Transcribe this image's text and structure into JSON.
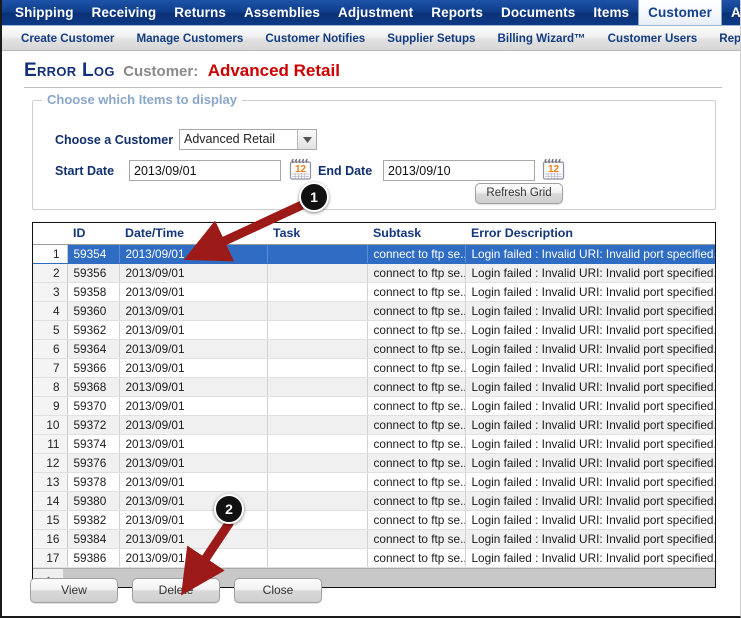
{
  "mainnav": {
    "items": [
      {
        "label": "Shipping",
        "active": false
      },
      {
        "label": "Receiving",
        "active": false
      },
      {
        "label": "Returns",
        "active": false
      },
      {
        "label": "Assemblies",
        "active": false
      },
      {
        "label": "Adjustment",
        "active": false
      },
      {
        "label": "Reports",
        "active": false
      },
      {
        "label": "Documents",
        "active": false
      },
      {
        "label": "Items",
        "active": false
      },
      {
        "label": "Customer",
        "active": true
      },
      {
        "label": "Ac",
        "active": false
      }
    ]
  },
  "subnav": {
    "items": [
      {
        "label": "Create Customer"
      },
      {
        "label": "Manage Customers"
      },
      {
        "label": "Customer Notifies"
      },
      {
        "label": "Supplier Setups"
      },
      {
        "label": "Billing Wizard™"
      },
      {
        "label": "Customer Users"
      },
      {
        "label": "Report Setups"
      }
    ]
  },
  "title": {
    "heading": "Error Log",
    "customer_label": "Customer:",
    "customer_name": "Advanced Retail"
  },
  "filter": {
    "legend": "Choose which Items to display",
    "customer_label": "Choose a Customer",
    "customer_value": "Advanced Retail",
    "start_label": "Start Date",
    "start_value": "2013/09/01",
    "end_label": "End Date",
    "end_value": "2013/09/10",
    "refresh_label": "Refresh Grid",
    "calendar_day": "12"
  },
  "grid": {
    "columns": [
      "",
      "ID",
      "Date/Time",
      "Task",
      "Subtask",
      "Error Description"
    ],
    "rows": [
      {
        "idx": "1",
        "id": "59354",
        "datetime": "2013/09/01",
        "task": "",
        "subtask": "connect to ftp se...",
        "error": "Login failed : Invalid URI: Invalid port specified.",
        "selected": true
      },
      {
        "idx": "2",
        "id": "59356",
        "datetime": "2013/09/01",
        "task": "",
        "subtask": "connect to ftp se...",
        "error": "Login failed : Invalid URI: Invalid port specified.",
        "selected": false
      },
      {
        "idx": "3",
        "id": "59358",
        "datetime": "2013/09/01",
        "task": "",
        "subtask": "connect to ftp se...",
        "error": "Login failed : Invalid URI: Invalid port specified.",
        "selected": false
      },
      {
        "idx": "4",
        "id": "59360",
        "datetime": "2013/09/01",
        "task": "",
        "subtask": "connect to ftp se...",
        "error": "Login failed : Invalid URI: Invalid port specified.",
        "selected": false
      },
      {
        "idx": "5",
        "id": "59362",
        "datetime": "2013/09/01",
        "task": "",
        "subtask": "connect to ftp se...",
        "error": "Login failed : Invalid URI: Invalid port specified.",
        "selected": false
      },
      {
        "idx": "6",
        "id": "59364",
        "datetime": "2013/09/01",
        "task": "",
        "subtask": "connect to ftp se...",
        "error": "Login failed : Invalid URI: Invalid port specified.",
        "selected": false
      },
      {
        "idx": "7",
        "id": "59366",
        "datetime": "2013/09/01",
        "task": "",
        "subtask": "connect to ftp se...",
        "error": "Login failed : Invalid URI: Invalid port specified.",
        "selected": false
      },
      {
        "idx": "8",
        "id": "59368",
        "datetime": "2013/09/01",
        "task": "",
        "subtask": "connect to ftp se...",
        "error": "Login failed : Invalid URI: Invalid port specified.",
        "selected": false
      },
      {
        "idx": "9",
        "id": "59370",
        "datetime": "2013/09/01",
        "task": "",
        "subtask": "connect to ftp se...",
        "error": "Login failed : Invalid URI: Invalid port specified.",
        "selected": false
      },
      {
        "idx": "10",
        "id": "59372",
        "datetime": "2013/09/01",
        "task": "",
        "subtask": "connect to ftp se...",
        "error": "Login failed : Invalid URI: Invalid port specified.",
        "selected": false
      },
      {
        "idx": "11",
        "id": "59374",
        "datetime": "2013/09/01",
        "task": "",
        "subtask": "connect to ftp se...",
        "error": "Login failed : Invalid URI: Invalid port specified.",
        "selected": false
      },
      {
        "idx": "12",
        "id": "59376",
        "datetime": "2013/09/01",
        "task": "",
        "subtask": "connect to ftp se...",
        "error": "Login failed : Invalid URI: Invalid port specified.",
        "selected": false
      },
      {
        "idx": "13",
        "id": "59378",
        "datetime": "2013/09/01",
        "task": "",
        "subtask": "connect to ftp se...",
        "error": "Login failed : Invalid URI: Invalid port specified.",
        "selected": false
      },
      {
        "idx": "14",
        "id": "59380",
        "datetime": "2013/09/01",
        "task": "",
        "subtask": "connect to ftp se...",
        "error": "Login failed : Invalid URI: Invalid port specified.",
        "selected": false
      },
      {
        "idx": "15",
        "id": "59382",
        "datetime": "2013/09/01",
        "task": "",
        "subtask": "connect to ftp se...",
        "error": "Login failed : Invalid URI: Invalid port specified.",
        "selected": false
      },
      {
        "idx": "16",
        "id": "59384",
        "datetime": "2013/09/01",
        "task": "",
        "subtask": "connect to ftp se...",
        "error": "Login failed : Invalid URI: Invalid port specified.",
        "selected": false
      },
      {
        "idx": "17",
        "id": "59386",
        "datetime": "2013/09/01",
        "task": "",
        "subtask": "connect to ftp se...",
        "error": "Login failed : Invalid URI: Invalid port specified.",
        "selected": false
      }
    ],
    "scroll_left_glyph": "‹"
  },
  "buttons": {
    "view": "View",
    "delete": "Delete",
    "close": "Close"
  },
  "annotations": [
    {
      "number": "1"
    },
    {
      "number": "2"
    }
  ],
  "colors": {
    "nav_blue": "#0f3e8c",
    "title_red": "#cc0000",
    "title_navy": "#14307a",
    "selection_blue": "#2f6dc4",
    "annotation_red": "#9c1a17",
    "legend_blue": "#8aa6c9"
  }
}
